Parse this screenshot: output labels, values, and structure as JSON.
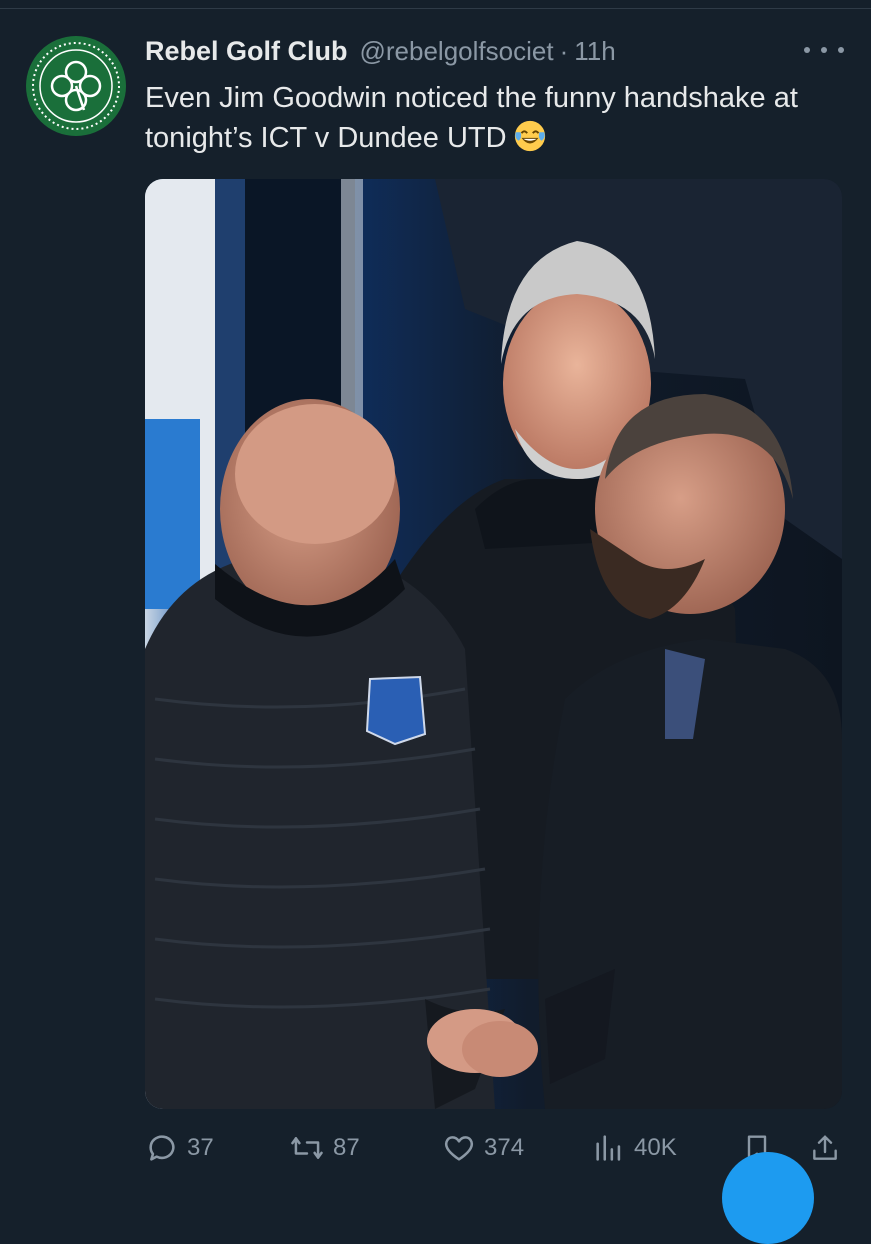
{
  "tweet": {
    "display_name": "Rebel Golf Club",
    "handle": "@rebelgolfsociet",
    "separator": "·",
    "time": "11h",
    "text": "Even Jim Goodwin noticed the funny handshake at tonight’s ICT v Dundee UTD",
    "emoji": "face-with-tears-of-joy"
  },
  "actions": {
    "replies": "37",
    "reposts": "87",
    "likes": "374",
    "views": "40K"
  },
  "colors": {
    "background": "#15202b",
    "text": "#e7e9ea",
    "muted": "#8b98a5",
    "accent": "#1d9bf0",
    "avatar": "#1a6f3a"
  },
  "icons": [
    "clover-logo-icon",
    "more-icon",
    "reply-icon",
    "repost-icon",
    "like-icon",
    "views-icon",
    "bookmark-icon",
    "share-icon",
    "compose-fab"
  ]
}
